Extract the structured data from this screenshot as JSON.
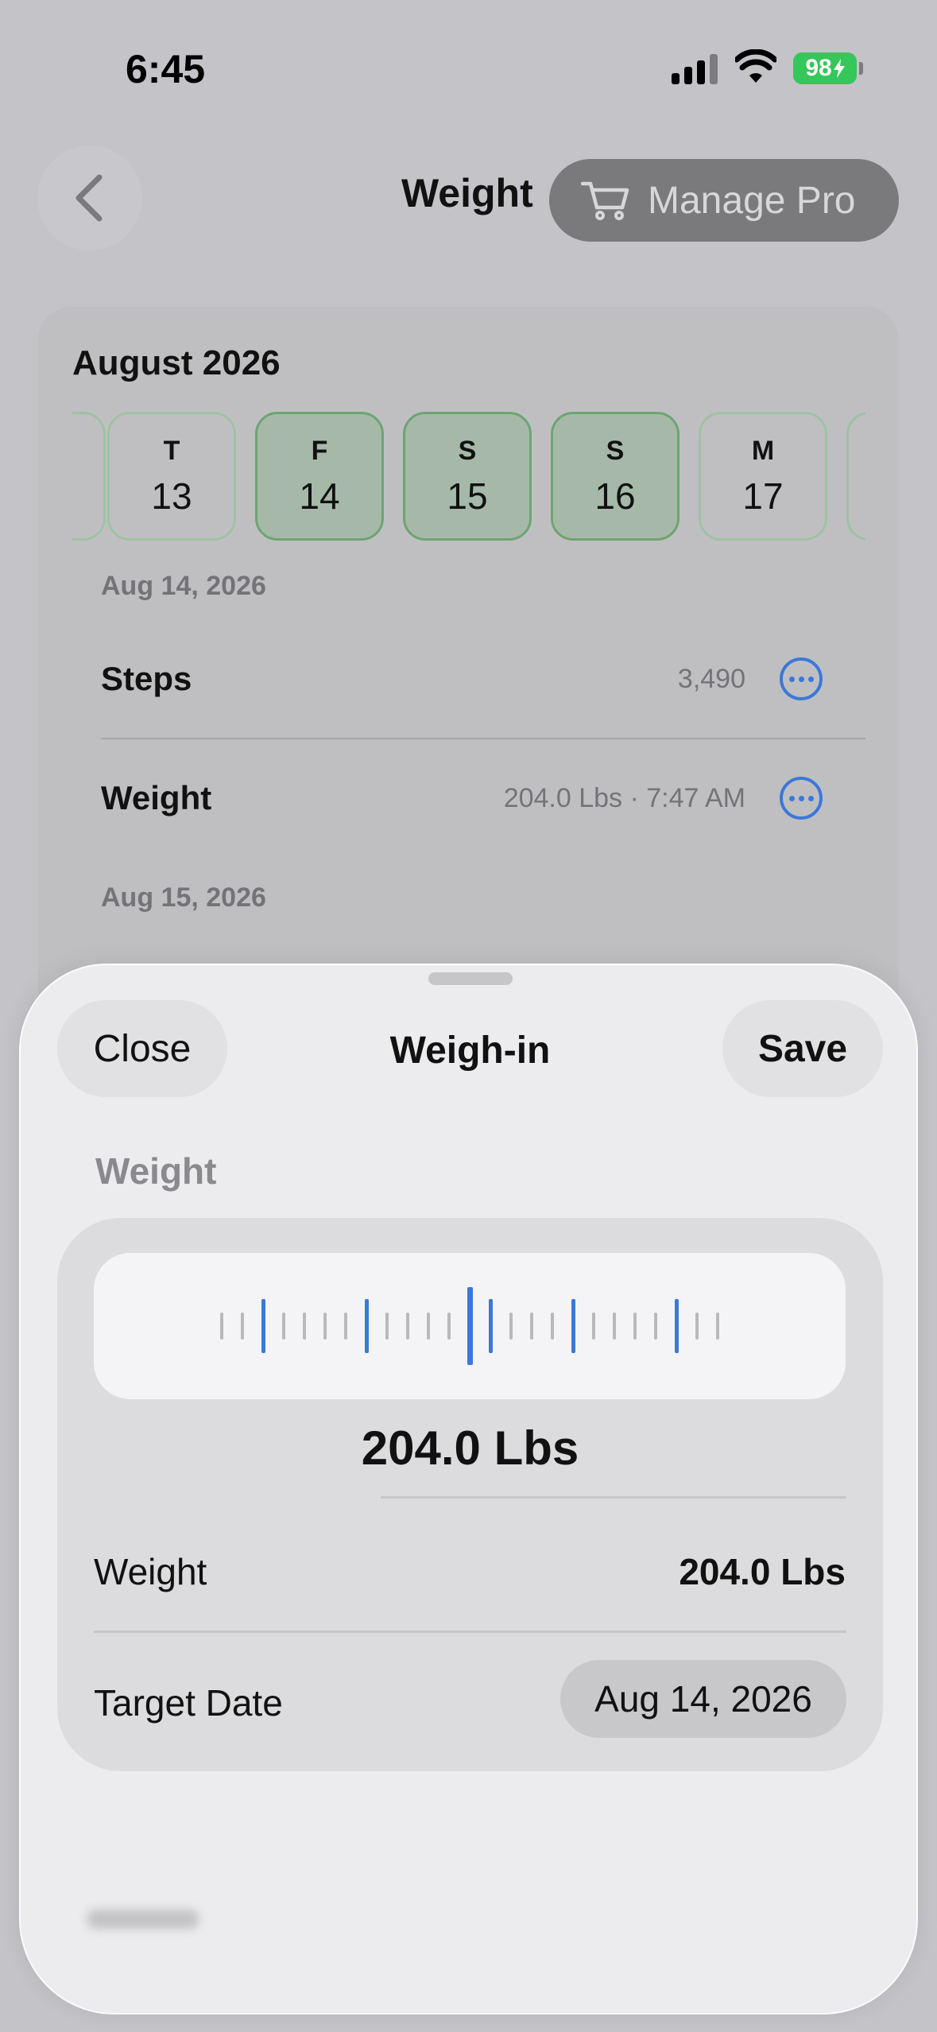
{
  "status_bar": {
    "time": "6:45",
    "battery": "98",
    "battery_color": "#35c759"
  },
  "nav": {
    "back_icon": "chevron-left-icon",
    "title": "Weight",
    "manage_pro_label": "Manage Pro",
    "manage_pro_icon": "cart-icon"
  },
  "calendar": {
    "month": "August 2026",
    "days": [
      {
        "letter": "T",
        "number": "13",
        "selected": false
      },
      {
        "letter": "F",
        "number": "14",
        "selected": true
      },
      {
        "letter": "S",
        "number": "15",
        "selected": true
      },
      {
        "letter": "S",
        "number": "16",
        "selected": true
      },
      {
        "letter": "M",
        "number": "17",
        "selected": false
      }
    ]
  },
  "log": {
    "groups": [
      {
        "date": "Aug 14, 2026",
        "entries": [
          {
            "label": "Steps",
            "value": "3,490"
          },
          {
            "label": "Weight",
            "value": "204.0 Lbs · 7:47 AM"
          }
        ]
      },
      {
        "date": "Aug 15, 2026"
      }
    ],
    "accent_color": "#3c78d8"
  },
  "sheet": {
    "close_label": "Close",
    "title": "Weigh-in",
    "save_label": "Save",
    "section_label": "Weight",
    "ruler_value": "204.0 Lbs",
    "weight_label": "Weight",
    "weight_value": "204.0 Lbs",
    "target_date_label": "Target Date",
    "target_date_value": "Aug 14, 2026"
  }
}
